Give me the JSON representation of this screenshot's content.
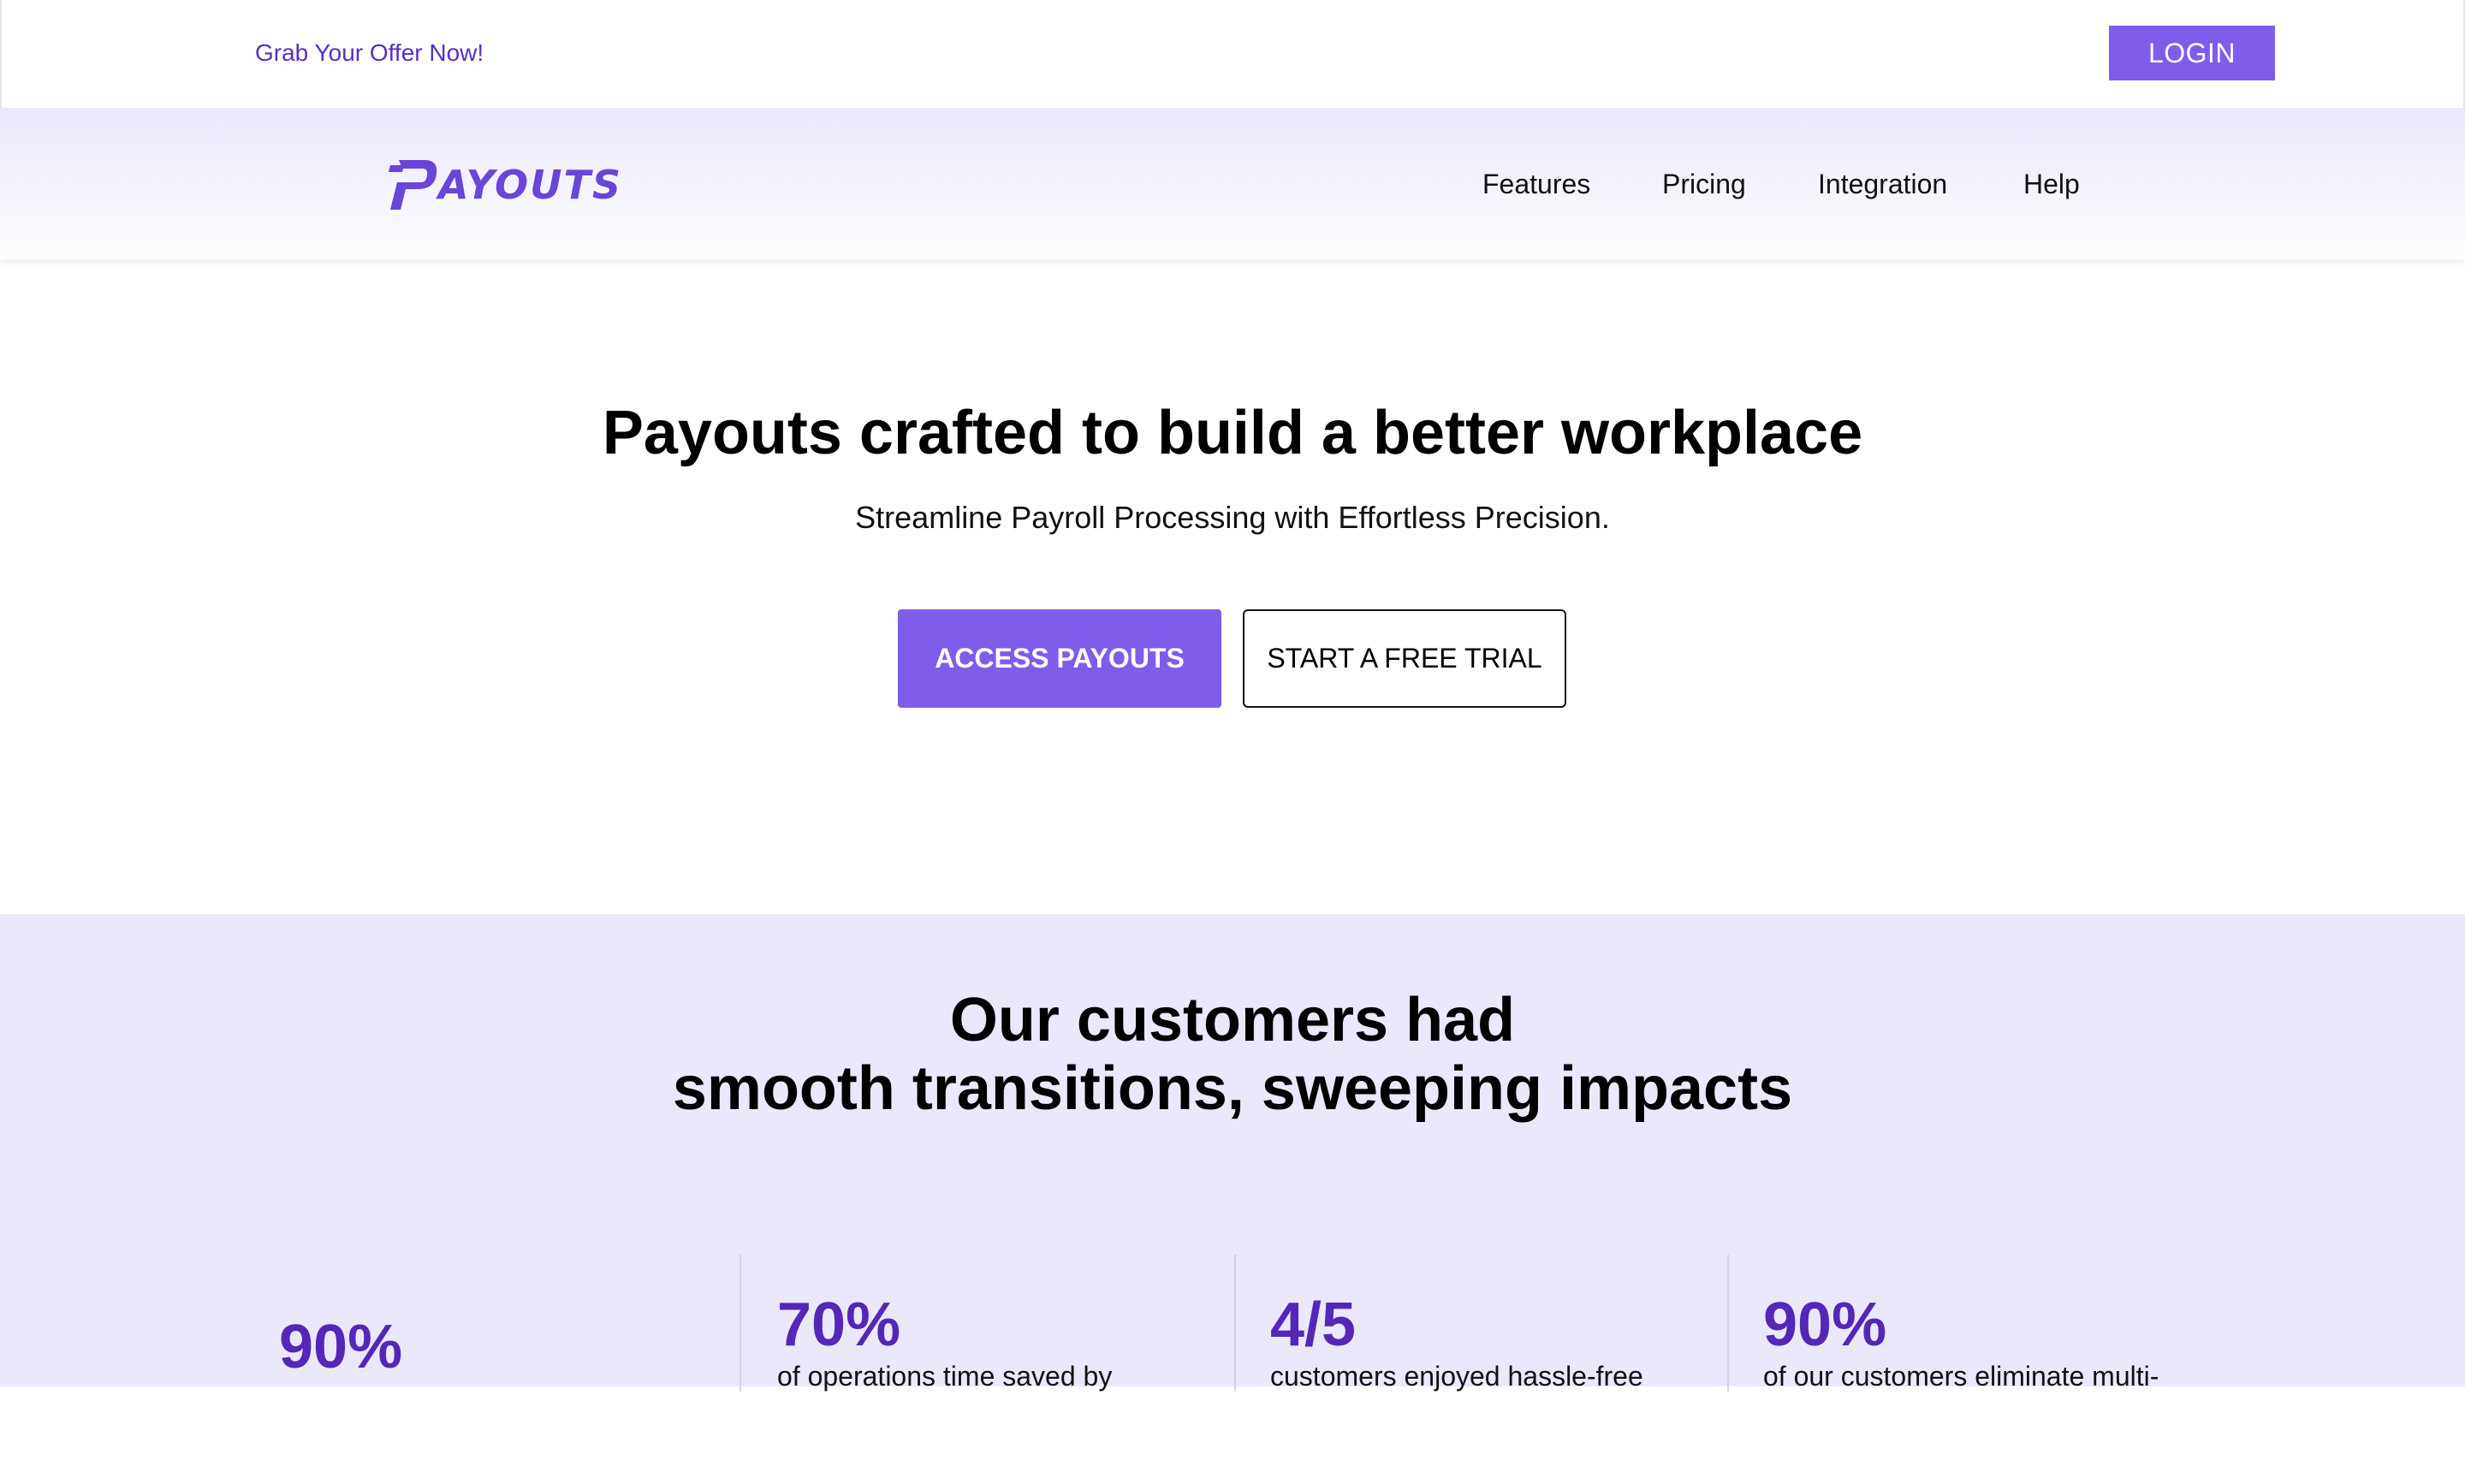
{
  "topbar": {
    "offer_link": "Grab Your Offer Now!",
    "login_label": "LOGIN"
  },
  "nav": {
    "logo_text": "AYOUTS",
    "items": [
      {
        "label": "Features"
      },
      {
        "label": "Pricing"
      },
      {
        "label": "Integration"
      },
      {
        "label": "Help"
      }
    ]
  },
  "hero": {
    "title": "Payouts crafted to build a better workplace",
    "subtitle": "Streamline Payroll Processing with Effortless Precision.",
    "primary_button": "ACCESS PAYOUTS",
    "secondary_button": "START A FREE TRIAL"
  },
  "stats": {
    "title_line1": "Our customers had",
    "title_line2": "smooth transitions, sweeping impacts",
    "items": [
      {
        "value": "90%",
        "text": ""
      },
      {
        "value": "70%",
        "text": "of operations time saved by"
      },
      {
        "value": "4/5",
        "text": "customers enjoyed hassle-free"
      },
      {
        "value": "90%",
        "text": "of our customers eliminate multi-"
      }
    ]
  },
  "colors": {
    "brand": "#7f5cea",
    "brand_dark": "#5427b8",
    "stats_bg": "#ebe8fb"
  }
}
